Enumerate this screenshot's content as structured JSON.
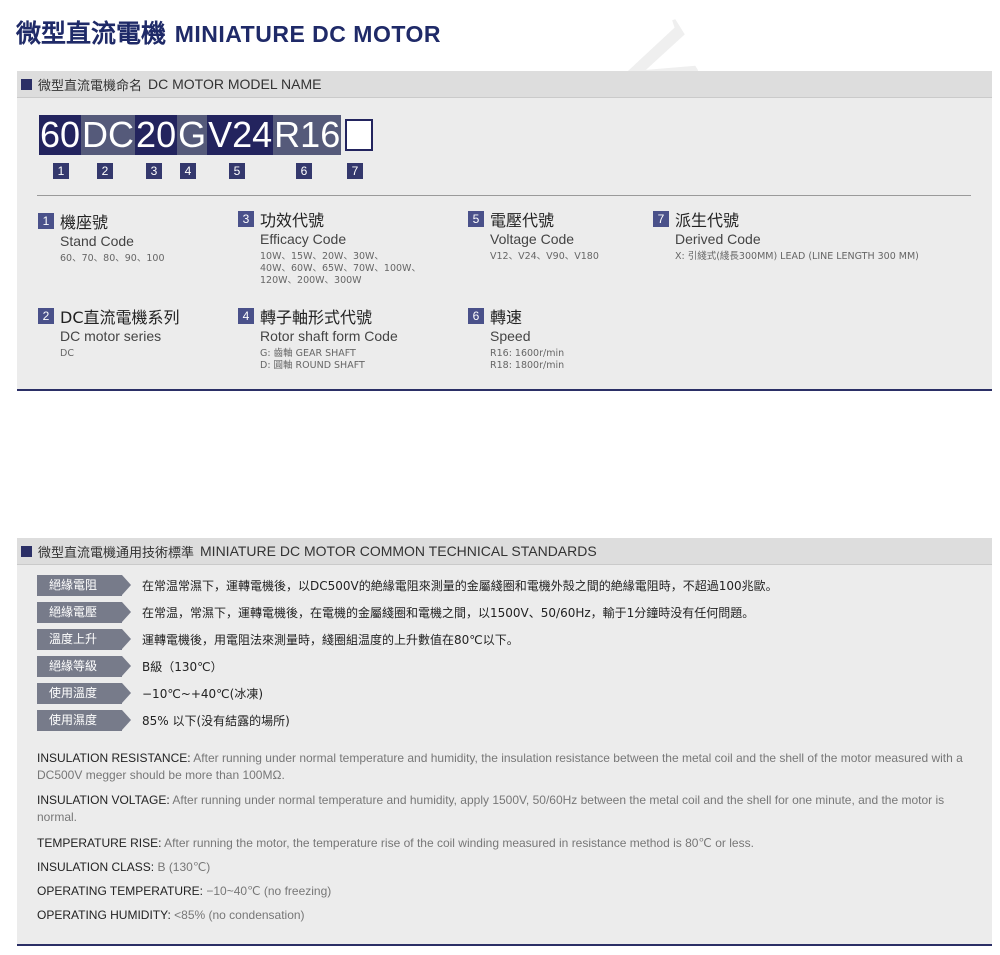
{
  "page_title": {
    "cn": "微型直流電機",
    "en": "MINIATURE DC MOTOR"
  },
  "model_section": {
    "title_cn": "微型直流電機命名",
    "title_en": "DC MOTOR MODEL NAME",
    "segments": [
      "60",
      "DC",
      "20",
      "G",
      "V24",
      "R16"
    ],
    "indices": [
      "1",
      "2",
      "3",
      "4",
      "5",
      "6",
      "7"
    ],
    "items": [
      {
        "num": "1",
        "cn": "機座號",
        "en": "Stand Code",
        "values": [
          "60、70、80、90、100"
        ]
      },
      {
        "num": "3",
        "cn": "功效代號",
        "en": "Efficacy Code",
        "values": [
          "10W、15W、20W、30W、",
          "40W、60W、65W、70W、100W、",
          "120W、200W、300W"
        ]
      },
      {
        "num": "5",
        "cn": "電壓代號",
        "en": "Voltage Code",
        "values": [
          "V12、V24、V90、V180"
        ]
      },
      {
        "num": "7",
        "cn": "派生代號",
        "en": "Derived Code",
        "values": [
          "X: 引綫式(綫長300MM) LEAD (LINE LENGTH 300 MM)"
        ]
      },
      {
        "num": "2",
        "cn": "DC直流電機系列",
        "en": "DC motor series",
        "values": [
          "DC"
        ]
      },
      {
        "num": "4",
        "cn": "轉子軸形式代號",
        "en": "Rotor shaft form Code",
        "values": [
          "G: 齒軸 GEAR SHAFT",
          "D: 圓軸 ROUND SHAFT"
        ]
      },
      {
        "num": "6",
        "cn": "轉速",
        "en": "Speed",
        "values": [
          "R16: 1600r/min",
          "R18: 1800r/min"
        ]
      }
    ]
  },
  "standards_section": {
    "title_cn": "微型直流電機通用技術標準",
    "title_en": "MINIATURE DC MOTOR COMMON TECHNICAL STANDARDS",
    "rows": [
      {
        "label": "絕緣電阻",
        "text": "在常温常濕下，運轉電機後，以DC500V的絶緣電阻來測量的金屬綫圈和電機外殻之間的絶緣電阻時，不超過100兆歐。"
      },
      {
        "label": "絕緣電壓",
        "text": "在常温，常濕下，運轉電機後，在電機的金屬綫圈和電機之間，以1500V、50/60Hz，輸于1分鐘時没有任何問題。"
      },
      {
        "label": "溫度上升",
        "text": "運轉電機後，用電阻法來測量時，綫圈組温度的上升數值在80℃以下。"
      },
      {
        "label": "絕緣等級",
        "text": "B級（130℃）"
      },
      {
        "label": "使用溫度",
        "text": "−10℃~+40℃(冰凍)"
      },
      {
        "label": "使用濕度",
        "text": "85% 以下(没有結露的場所)"
      }
    ],
    "english": [
      {
        "label": "INSULATION RESISTANCE:",
        "text": " After running under normal temperature and humidity, the insulation resistance between the metal coil and the shell of the motor measured with a DC500V megger should be more than 100MΩ."
      },
      {
        "label": "INSULATION VOLTAGE:",
        "text": " After running under normal temperature and humidity, apply 1500V, 50/60Hz between the metal coil and the shell for one minute, and the motor is normal."
      },
      {
        "label": "TEMPERATURE RISE:",
        "text": " After running the motor, the temperature rise of the coil winding measured in resistance method is 80℃ or less."
      },
      {
        "label": "INSULATION CLASS:",
        "text": " B (130℃)"
      },
      {
        "label": "OPERATING TEMPERATURE:",
        "text": " −10~40℃ (no freezing)"
      },
      {
        "label": "OPERATING HUMIDITY:",
        "text": " <85% (no condensation)"
      }
    ]
  },
  "colors": {
    "navy": "#23245e",
    "label_gray": "#777b8a",
    "panel_bg": "#ececec"
  }
}
